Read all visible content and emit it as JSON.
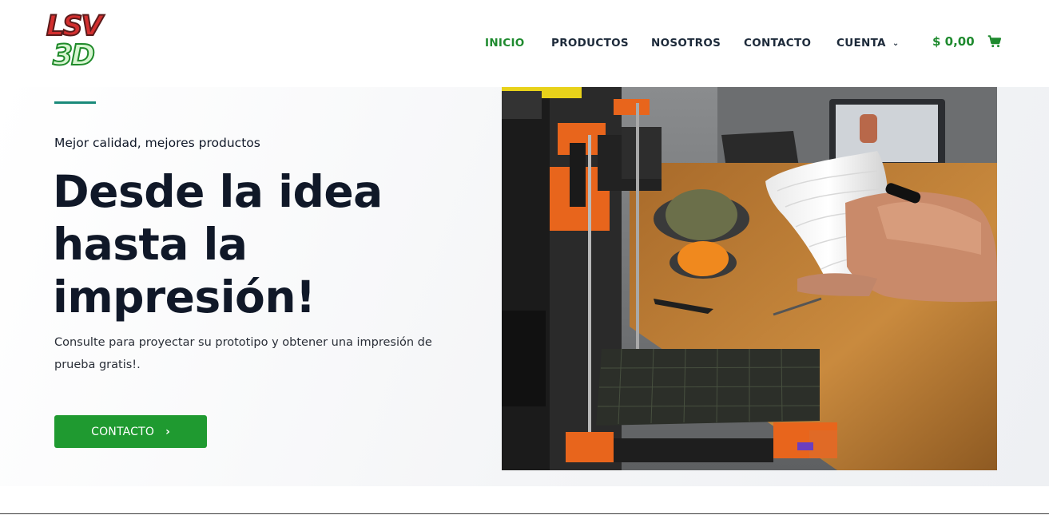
{
  "brand": {
    "logo_top": "LSV",
    "logo_bottom": "3D",
    "logo_top_color": "#d32f2f",
    "logo_bottom_color": "#1f8a2a"
  },
  "nav": {
    "items": [
      {
        "label": "INICIO",
        "active": true
      },
      {
        "label": "PRODUCTOS",
        "active": false
      },
      {
        "label": "NOSOTROS",
        "active": false
      },
      {
        "label": "CONTACTO",
        "active": false
      },
      {
        "label": "CUENTA",
        "active": false,
        "has_dropdown": true
      }
    ],
    "dropdown_icon": "chevron-down-icon",
    "active_color": "#1e8a2e"
  },
  "cart": {
    "amount": "$ 0,00",
    "icon": "shopping-cart-icon",
    "color": "#1e8a2e"
  },
  "hero": {
    "subtitle": "Mejor calidad, mejores productos",
    "title": "Desde la idea hasta la impresión!",
    "description": "Consulte para proyectar su prototipo y obtener una impresión de prueba gratis!.",
    "cta_label": "CONTACTO",
    "cta_icon": "chevron-right-icon",
    "cta_color": "#1f9a30",
    "accent_color": "#1a8a7a",
    "image": "3d-printer-photo"
  }
}
